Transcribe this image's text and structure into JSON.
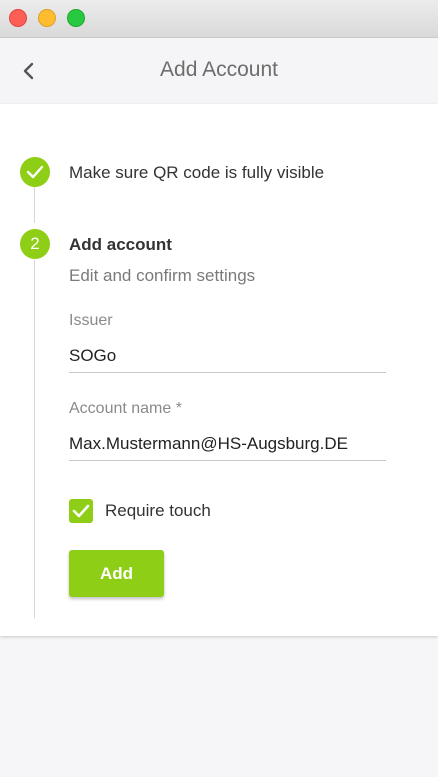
{
  "header": {
    "title": "Add Account",
    "back_icon": "chevron-left-icon"
  },
  "steps": {
    "step1": {
      "label": "Make sure QR code is fully visible",
      "icon": "check-circle-icon",
      "completed": true
    },
    "step2": {
      "number": "2",
      "title": "Add account",
      "subtitle": "Edit and confirm settings"
    }
  },
  "form": {
    "issuer_label": "Issuer",
    "issuer_value": "SOGo",
    "account_name_label": "Account name *",
    "account_name_value": "Max.Mustermann@HS-Augsburg.DE",
    "require_touch_label": "Require touch",
    "require_touch_checked": true,
    "add_button_label": "Add"
  },
  "colors": {
    "accent": "#8fce16",
    "close": "#fd5f57",
    "minimize": "#febc2e",
    "maximize": "#28c840"
  }
}
